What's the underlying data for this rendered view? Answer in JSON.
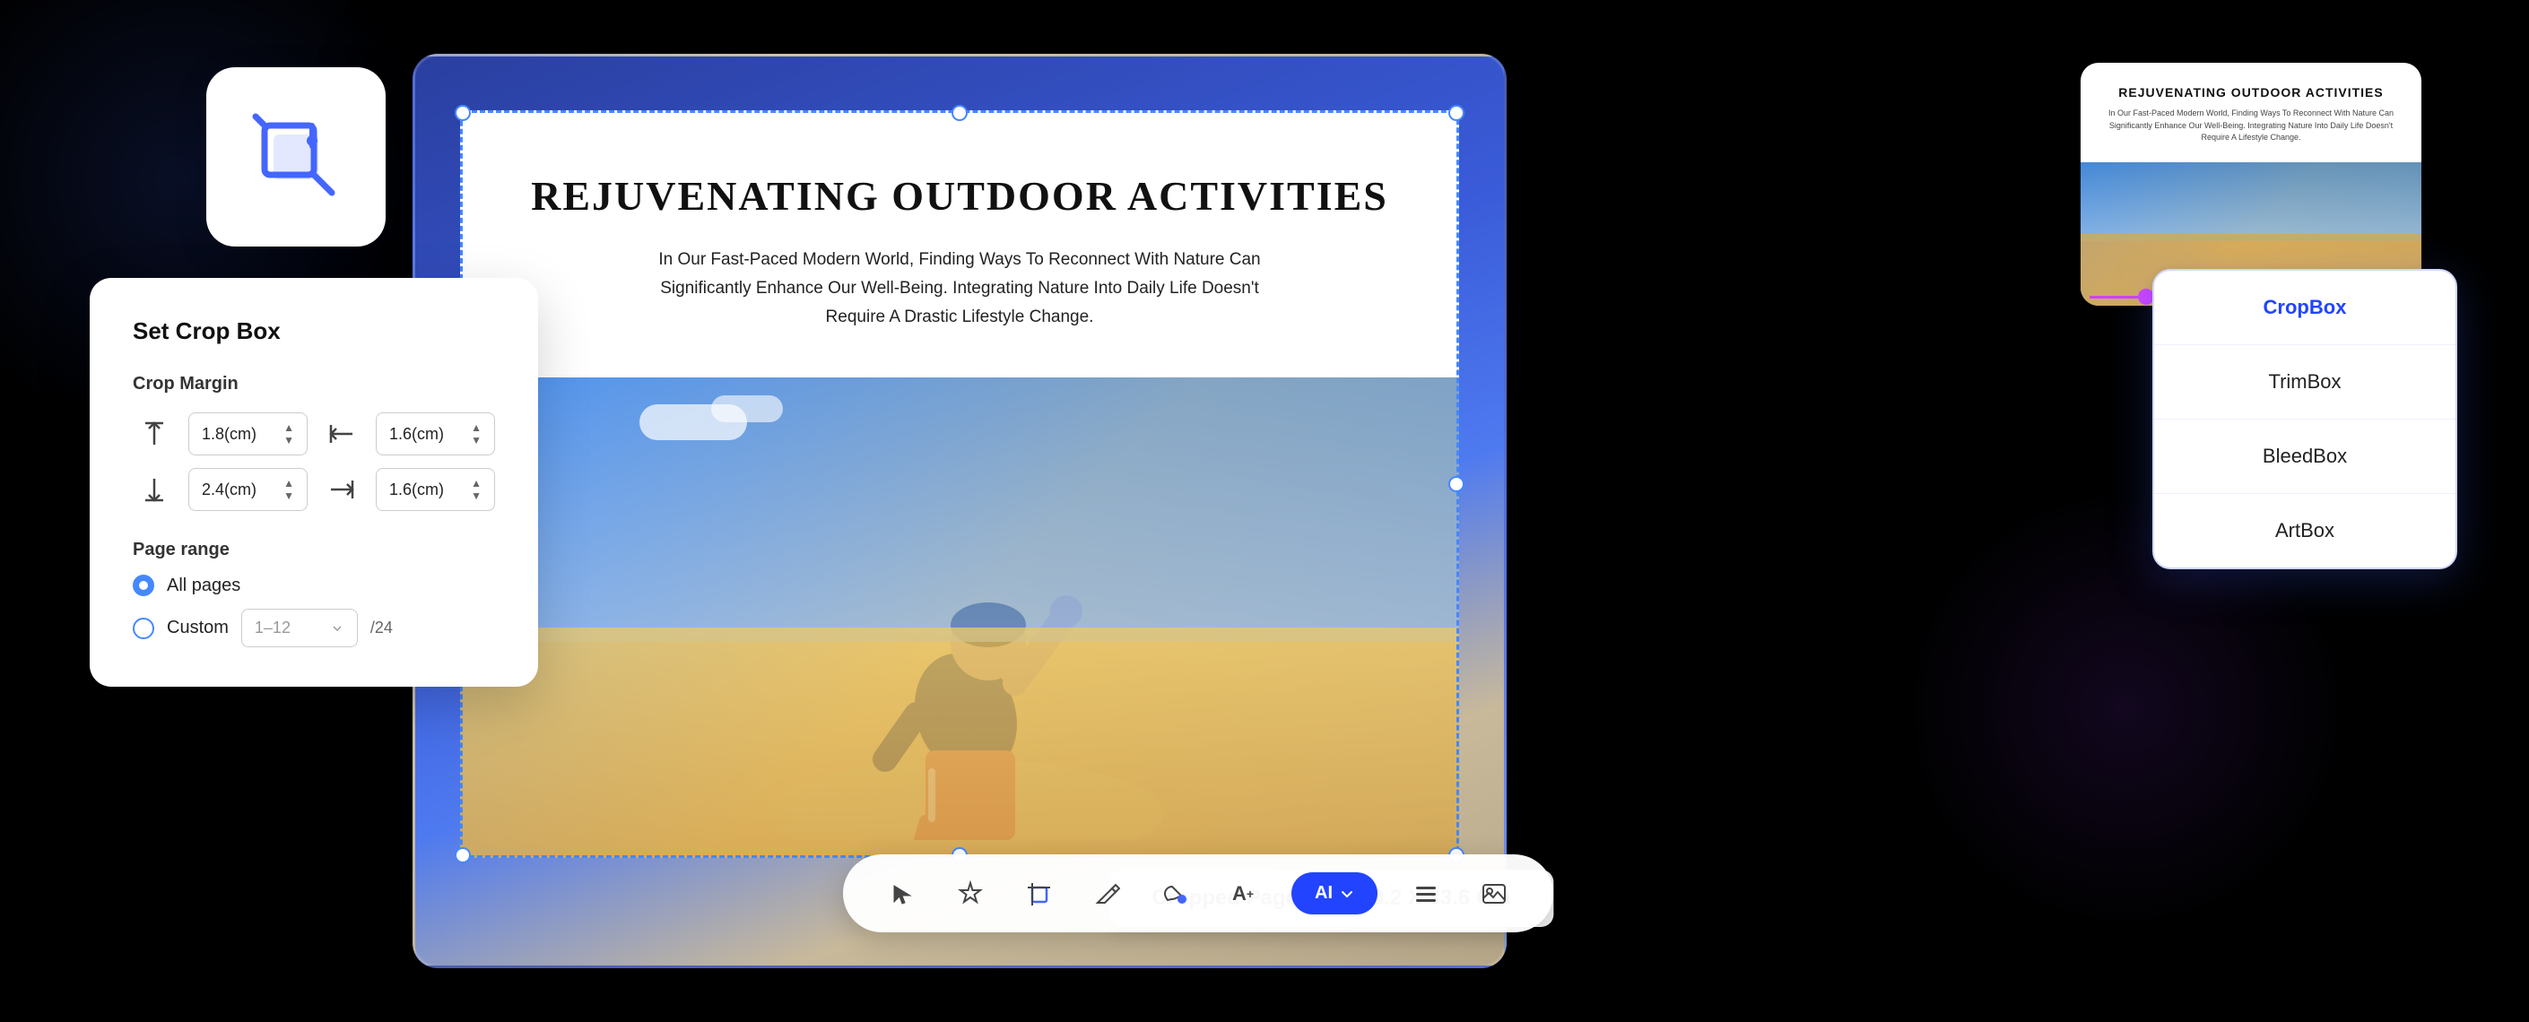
{
  "scene": {
    "background": "#000000"
  },
  "cropIconCard": {
    "tooltip": "Crop tool"
  },
  "mainCard": {
    "pdfContent": {
      "title": "Rejuvenating Outdoor Activities",
      "subtitle": "In Our Fast-Paced Modern World, Finding Ways To Reconnect With Nature Can Significantly Enhance Our Well-Being. Integrating Nature Into Daily Life Doesn't Require A Drastic Lifestyle Change.",
      "croppedPageSize": "Cropped Page Size: 50.2 X 33.6 Cm"
    }
  },
  "miniPreview": {
    "title": "Rejuvenating Outdoor Activities",
    "body": "In Our Fast-Paced Modern World, Finding Ways To Reconnect With Nature Can Significantly Enhance Our Well-Being. Integrating Nature Into Daily Life Doesn't Require A Lifestyle Change."
  },
  "cropBoxDropdown": {
    "items": [
      {
        "label": "CropBox",
        "selected": true
      },
      {
        "label": "TrimBox",
        "selected": false
      },
      {
        "label": "BleedBox",
        "selected": false
      },
      {
        "label": "ArtBox",
        "selected": false
      }
    ]
  },
  "cropPanel": {
    "title": "Set Crop Box",
    "marginLabel": "Crop Margin",
    "margins": {
      "top": "1.8(cm)",
      "bottom": "2.4(cm)",
      "left": "1.6(cm)",
      "right": "1.6(cm)"
    },
    "pageRange": {
      "label": "Page range",
      "options": [
        {
          "label": "All pages",
          "selected": true
        },
        {
          "label": "Custom",
          "selected": false
        }
      ],
      "customPlaceholder": "1–12",
      "totalPages": "/24"
    }
  },
  "toolbar": {
    "icons": [
      {
        "name": "select-icon",
        "symbol": "⬚",
        "active": false
      },
      {
        "name": "star-icon",
        "symbol": "✦",
        "active": false
      },
      {
        "name": "crop-icon",
        "symbol": "⊡",
        "active": false
      },
      {
        "name": "edit-icon",
        "symbol": "✏",
        "active": false
      },
      {
        "name": "fill-icon",
        "symbol": "⬤",
        "active": false
      },
      {
        "name": "text-add-icon",
        "symbol": "A+",
        "active": false
      },
      {
        "name": "ai-label",
        "symbol": "AI",
        "active": true
      },
      {
        "name": "list-icon",
        "symbol": "☰",
        "active": false
      },
      {
        "name": "image-icon",
        "symbol": "⊞",
        "active": false
      }
    ]
  }
}
